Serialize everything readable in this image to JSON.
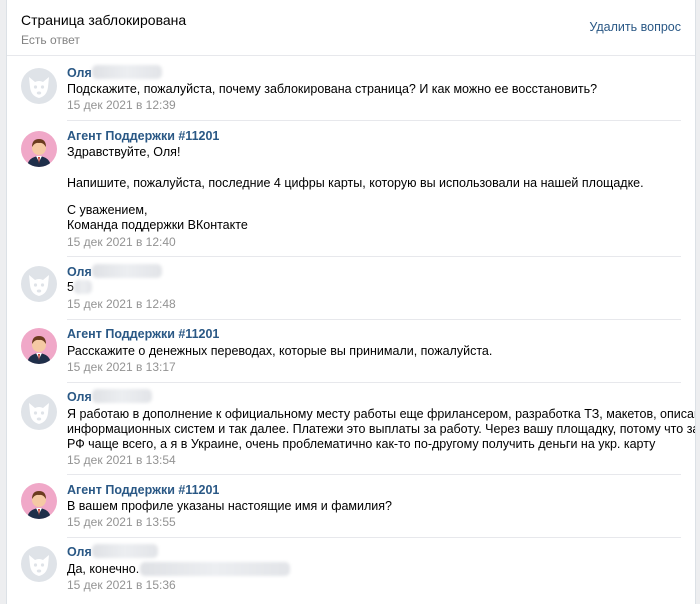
{
  "header": {
    "title": "Страница заблокирована",
    "status": "Есть ответ",
    "delete_label": "Удалить вопрос"
  },
  "messages": [
    {
      "author": "Оля",
      "lines": [
        "Подскажите, пожалуйста, почему заблокирована страница? И как можно ее восстановить?"
      ],
      "time": "15 дек 2021 в 12:39"
    },
    {
      "author": "Агент Поддержки #11201",
      "lines": [
        "Здравствуйте, Оля!",
        "",
        "Напишите, пожалуйста, последние 4 цифры карты, которую вы использовали на нашей площадке.",
        "",
        "С уважением,",
        "Команда поддержки ВКонтакте"
      ],
      "time": "15 дек 2021 в 12:40"
    },
    {
      "author": "Оля",
      "lines": [
        "5"
      ],
      "time": "15 дек 2021 в 12:48"
    },
    {
      "author": "Агент Поддержки #11201",
      "lines": [
        "Расскажите о денежных переводах, которые вы принимали, пожалуйста."
      ],
      "time": "15 дек 2021 в 13:17"
    },
    {
      "author": "Оля",
      "lines": [
        "Я работаю в дополнение к официальному месту работы еще фрилансером, разработка ТЗ, макетов, описание для",
        "информационных систем и так далее. Платежи это выплаты за работу. Через вашу площадку, потому что заказчики из",
        "РФ чаще всего, а я в Украине, очень проблематично как-то по-другому получить деньги на укр. карту"
      ],
      "time": "15 дек 2021 в 13:54"
    },
    {
      "author": "Агент Поддержки #11201",
      "lines": [
        "В вашем профиле указаны настоящие имя и фамилия?"
      ],
      "time": "15 дек 2021 в 13:55"
    },
    {
      "author": "Оля",
      "lines": [
        "Да, конечно."
      ],
      "time": "15 дек 2021 в 15:36"
    }
  ],
  "icons": {
    "user_avatar": "dog-avatar-icon",
    "agent_avatar": "agent-avatar-icon"
  },
  "colors": {
    "link": "#2a5885",
    "time": "#939393",
    "background": "#edeef0"
  }
}
